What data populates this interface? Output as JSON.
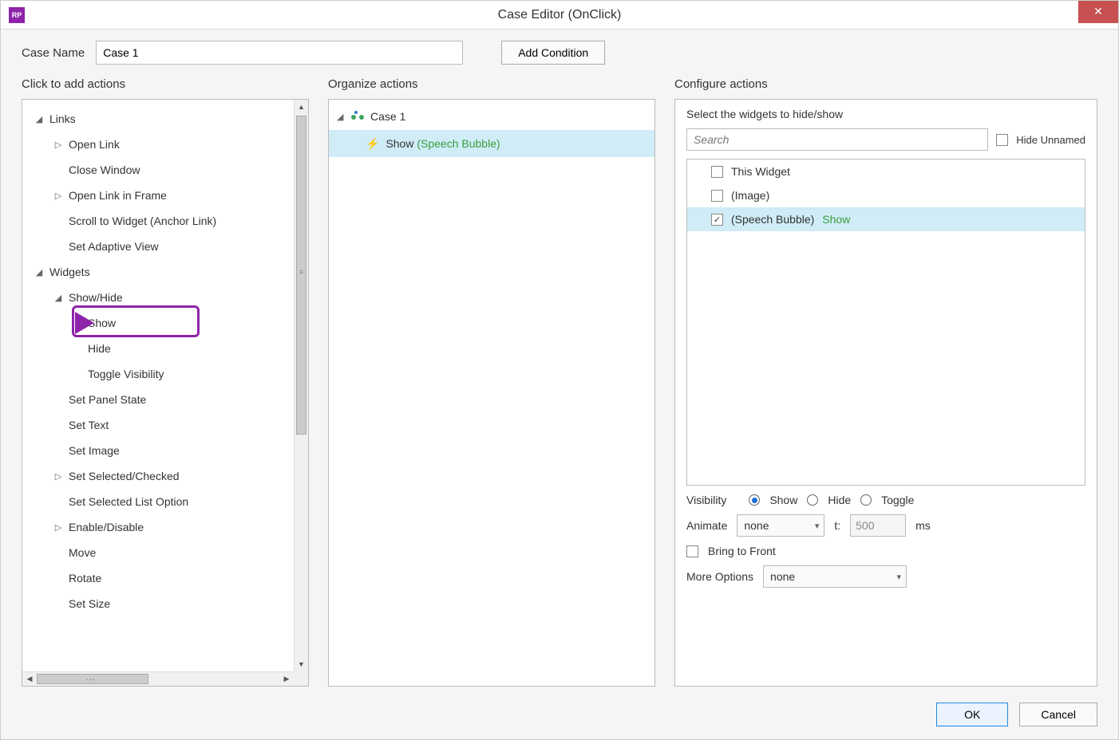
{
  "window": {
    "title": "Case Editor (OnClick)",
    "app_icon_text": "RP"
  },
  "toprow": {
    "case_name_label": "Case Name",
    "case_name_value": "Case 1",
    "add_condition_label": "Add Condition"
  },
  "left": {
    "header": "Click to add actions",
    "items": [
      {
        "level": 0,
        "glyph": "◢",
        "label": "Links"
      },
      {
        "level": 1,
        "glyph": "▷",
        "label": "Open Link"
      },
      {
        "level": 1,
        "glyph": "",
        "label": "Close Window"
      },
      {
        "level": 1,
        "glyph": "▷",
        "label": "Open Link in Frame"
      },
      {
        "level": 1,
        "glyph": "",
        "label": "Scroll to Widget (Anchor Link)"
      },
      {
        "level": 1,
        "glyph": "",
        "label": "Set Adaptive View"
      },
      {
        "level": 0,
        "glyph": "◢",
        "label": "Widgets"
      },
      {
        "level": 1,
        "glyph": "◢",
        "label": "Show/Hide"
      },
      {
        "level": 2,
        "glyph": "",
        "label": "Show",
        "highlighted": true
      },
      {
        "level": 2,
        "glyph": "",
        "label": "Hide"
      },
      {
        "level": 2,
        "glyph": "",
        "label": "Toggle Visibility"
      },
      {
        "level": 1,
        "glyph": "",
        "label": "Set Panel State"
      },
      {
        "level": 1,
        "glyph": "",
        "label": "Set Text"
      },
      {
        "level": 1,
        "glyph": "",
        "label": "Set Image"
      },
      {
        "level": 1,
        "glyph": "▷",
        "label": "Set Selected/Checked"
      },
      {
        "level": 1,
        "glyph": "",
        "label": "Set Selected List Option"
      },
      {
        "level": 1,
        "glyph": "▷",
        "label": "Enable/Disable"
      },
      {
        "level": 1,
        "glyph": "",
        "label": "Move"
      },
      {
        "level": 1,
        "glyph": "",
        "label": "Rotate"
      },
      {
        "level": 1,
        "glyph": "",
        "label": "Set Size"
      }
    ]
  },
  "mid": {
    "header": "Organize actions",
    "case_label": "Case 1",
    "action_name": "Show",
    "action_target": "(Speech Bubble)"
  },
  "right": {
    "header": "Configure actions",
    "instruction": "Select the widgets to hide/show",
    "search_placeholder": "Search",
    "hide_unnamed_label": "Hide Unnamed",
    "widgets": [
      {
        "checked": false,
        "label": "This Widget",
        "suffix": ""
      },
      {
        "checked": false,
        "label": "(Image)",
        "suffix": ""
      },
      {
        "checked": true,
        "label": "(Speech Bubble)",
        "suffix": "Show",
        "selected": true
      }
    ],
    "visibility_label": "Visibility",
    "visibility_options": {
      "show": "Show",
      "hide": "Hide",
      "toggle": "Toggle"
    },
    "visibility_value": "show",
    "animate_label": "Animate",
    "animate_value": "none",
    "t_label": "t:",
    "t_value": "500",
    "t_unit": "ms",
    "bring_front_label": "Bring to Front",
    "bring_front_checked": false,
    "more_options_label": "More Options",
    "more_options_value": "none"
  },
  "footer": {
    "ok": "OK",
    "cancel": "Cancel"
  }
}
